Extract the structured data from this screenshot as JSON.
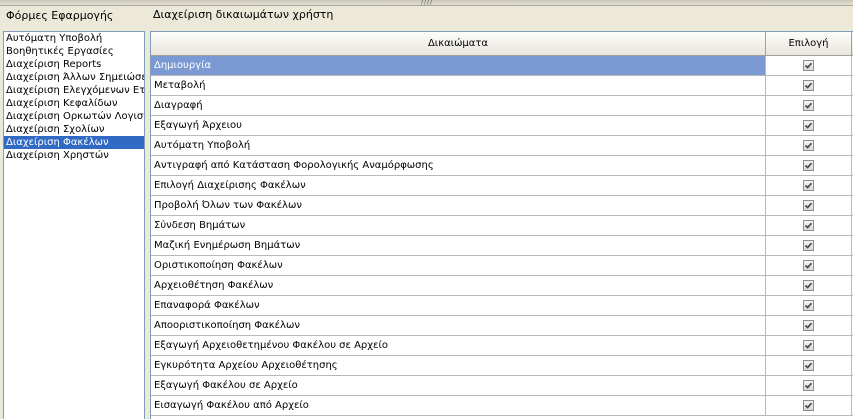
{
  "left_title": "Φόρμες Εφαρμογής",
  "right_title": "Διαχείριση δικαιωμάτων χρήστη",
  "grip": "////",
  "forms": [
    {
      "label": "Αυτόματη Υποβολή",
      "selected": false
    },
    {
      "label": "Βοηθητικές Εργασίες",
      "selected": false
    },
    {
      "label": "Διαχείριση Reports",
      "selected": false
    },
    {
      "label": "Διαχείριση Άλλων Σημειώσεων",
      "selected": false
    },
    {
      "label": "Διαχείριση Ελεγχόμενων Εταιρειών",
      "selected": false
    },
    {
      "label": "Διαχείριση Κεφαλίδων",
      "selected": false
    },
    {
      "label": "Διαχείριση Ορκωτών Λογιστών",
      "selected": false
    },
    {
      "label": "Διαχείριση Σχολίων",
      "selected": false
    },
    {
      "label": "Διαχείριση Φακέλων",
      "selected": true
    },
    {
      "label": "Διαχείριση Χρηστών",
      "selected": false
    }
  ],
  "grid": {
    "col_name": "Δικαιώματα",
    "col_pick": "Επιλογή",
    "rows": [
      {
        "label": "Δημιουργία",
        "checked": true,
        "selected": true
      },
      {
        "label": "Μεταβολή",
        "checked": true,
        "selected": false
      },
      {
        "label": "Διαγραφή",
        "checked": true,
        "selected": false
      },
      {
        "label": "Εξαγωγή Άρχειου",
        "checked": true,
        "selected": false
      },
      {
        "label": "Αυτόματη Υποβολή",
        "checked": true,
        "selected": false
      },
      {
        "label": "Αντιγραφή από Κατάσταση Φορολογικής Αναμόρφωσης",
        "checked": true,
        "selected": false
      },
      {
        "label": "Επιλογή Διαχείρισης Φακέλων",
        "checked": true,
        "selected": false
      },
      {
        "label": "Προβολή Όλων των Φακέλων",
        "checked": true,
        "selected": false
      },
      {
        "label": "Σύνδεση Βημάτων",
        "checked": true,
        "selected": false
      },
      {
        "label": "Μαζική Ενημέρωση Βημάτων",
        "checked": true,
        "selected": false
      },
      {
        "label": "Οριστικοποίηση Φακέλων",
        "checked": true,
        "selected": false
      },
      {
        "label": "Αρχειοθέτηση Φακέλων",
        "checked": true,
        "selected": false
      },
      {
        "label": "Επαναφορά Φακέλων",
        "checked": true,
        "selected": false
      },
      {
        "label": "Αποοριστικοποίηση Φακέλων",
        "checked": true,
        "selected": false
      },
      {
        "label": "Εξαγωγή Αρχειοθετημένου Φακέλου σε Αρχείο",
        "checked": true,
        "selected": false
      },
      {
        "label": "Εγκυρότητα Αρχείου Αρχειοθέτησης",
        "checked": true,
        "selected": false
      },
      {
        "label": "Εξαγωγή Φακέλου σε Αρχείο",
        "checked": true,
        "selected": false
      },
      {
        "label": "Εισαγωγή Φακέλου από Αρχείο",
        "checked": true,
        "selected": false
      }
    ]
  },
  "colors": {
    "window_bg": "#ece9d8",
    "list_selected_bg": "#316ac5",
    "row_selected_bg": "#7b9ad4",
    "border": "#7f9db9"
  }
}
